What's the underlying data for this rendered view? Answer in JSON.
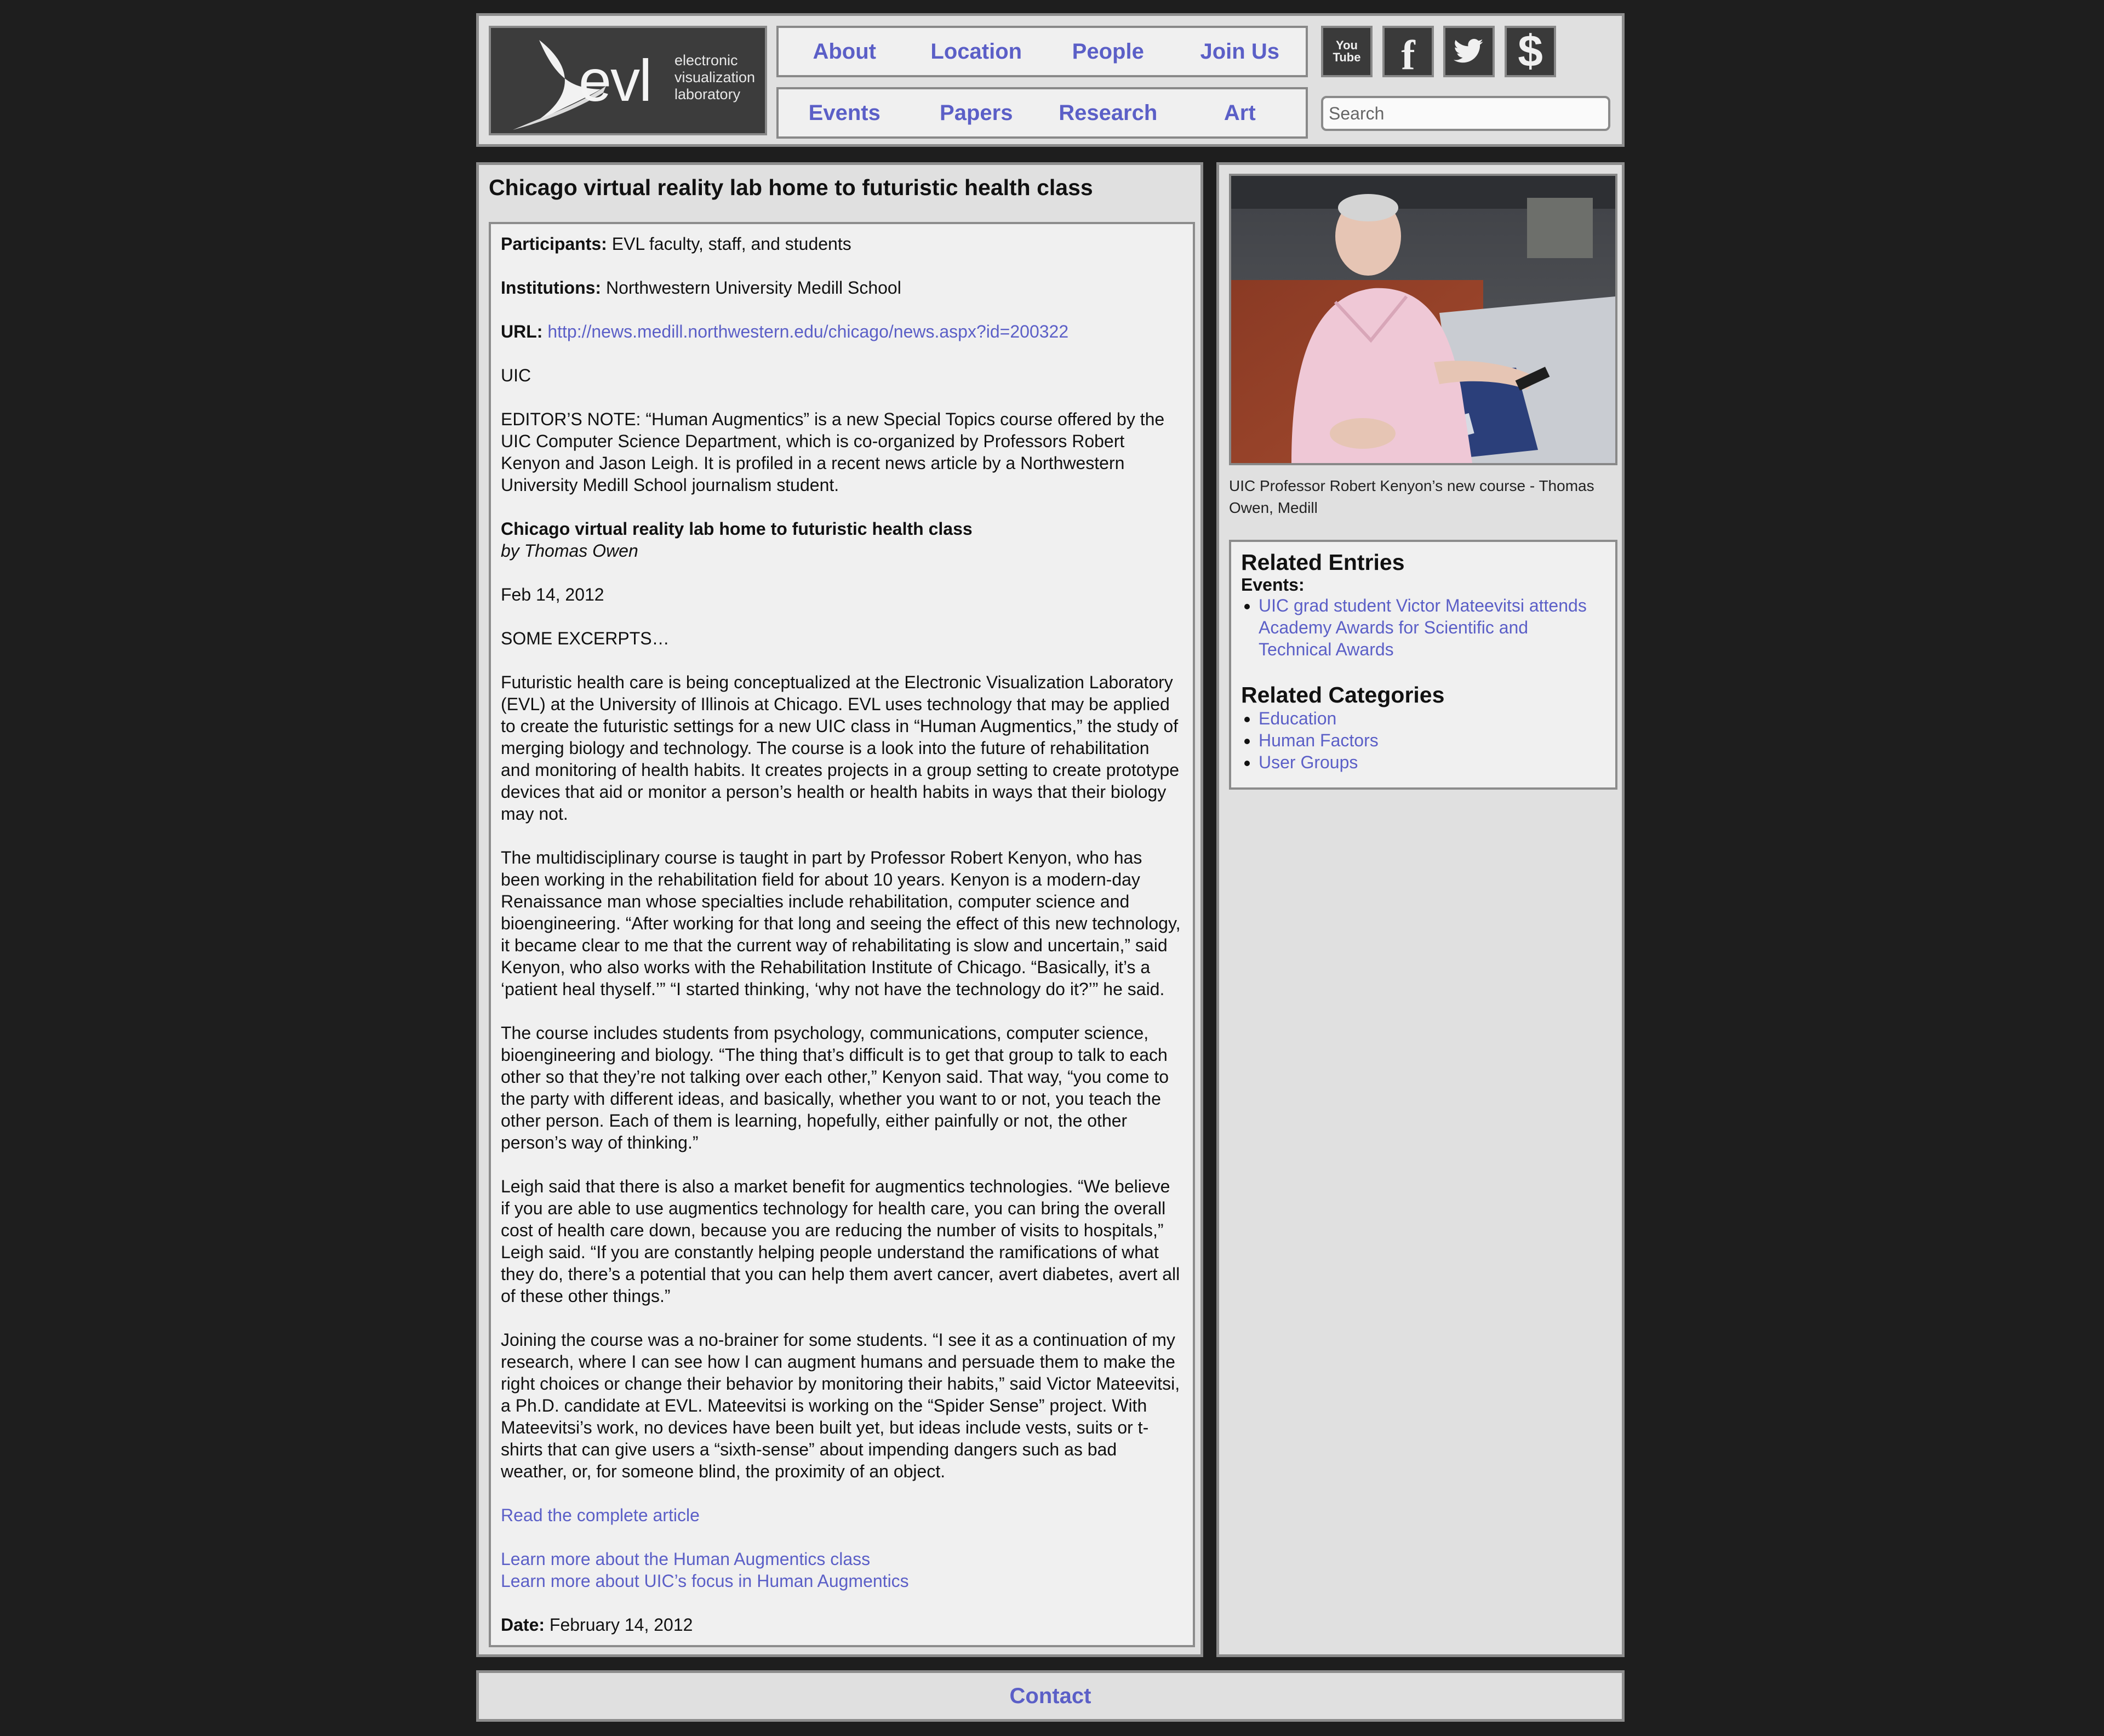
{
  "header": {
    "logo": {
      "wordmark": "evl",
      "lines": [
        "electronic",
        "visualization",
        "laboratory"
      ]
    },
    "nav_row1": [
      "About",
      "Location",
      "People",
      "Join Us"
    ],
    "nav_row2": [
      "Events",
      "Papers",
      "Research",
      "Art"
    ],
    "social": {
      "youtube_label": "You Tube",
      "icons": [
        "youtube-icon",
        "facebook-icon",
        "twitter-icon",
        "dollar-icon"
      ]
    },
    "search_placeholder": "Search"
  },
  "article": {
    "title": "Chicago virtual reality lab home to futuristic health class",
    "participants_label": "Participants:",
    "participants": "EVL faculty, staff, and students",
    "institutions_label": "Institutions:",
    "institutions": "Northwestern University Medill School",
    "url_label": "URL:",
    "url": "http://news.medill.northwestern.edu/chicago/news.aspx?id=200322",
    "uic": "UIC",
    "editors_note": "EDITOR’S NOTE: “Human Augmentics” is a new Special Topics course offered by the UIC Computer Science Department, which is co-organized by Professors Robert Kenyon and Jason Leigh. It is profiled in a recent news article by a Northwestern University Medill School journalism student.",
    "headline": "Chicago virtual reality lab home to futuristic health class",
    "byline": "by Thomas Owen",
    "pub_date": "Feb 14, 2012",
    "excerpts_label": "SOME EXCERPTS…",
    "paragraphs": [
      "Futuristic health care is being conceptualized at the Electronic Visualization Laboratory (EVL) at the University of Illinois at Chicago. EVL uses technology that may be applied to create the futuristic settings for a new UIC class in “Human Augmentics,” the study of merging biology and technology. The course is a look into the future of rehabilitation and monitoring of health habits. It creates projects in a group setting to create prototype devices that aid or monitor a person’s health or health habits in ways that their biology may not.",
      "The multidisciplinary course is taught in part by Professor Robert Kenyon, who has been working in the rehabilitation field for about 10 years. Kenyon is a modern-day Renaissance man whose specialties include rehabilitation, computer science and bioengineering. “After working for that long and seeing the effect of this new technology, it became clear to me that the current way of rehabilitating is slow and uncertain,” said Kenyon, who also works with the Rehabilitation Institute of Chicago. “Basically, it’s a ‘patient heal thyself.’” “I started thinking, ‘why not have the technology do it?’” he said.",
      "The course includes students from psychology, communications, computer science, bioengineering and biology. “The thing that’s difficult is to get that group to talk to each other so that they’re not talking over each other,” Kenyon said. That way, “you come to the party with different ideas, and basically, whether you want to or not, you teach the other person. Each of them is learning, hopefully, either painfully or not, the other person’s way of thinking.”",
      "Leigh said that there is also a market benefit for augmentics technologies. “We believe if you are able to use augmentics technology for health care, you can bring the overall cost of health care down, because you are reducing the number of visits to hospitals,” Leigh said. “If you are constantly helping people understand the ramifications of what they do, there’s a potential that you can help them avert cancer, avert diabetes, avert all of these other things.”",
      "Joining the course was a no-brainer for some students. “I see it as a continuation of my research, where I can see how I can augment humans and persuade them to make the right choices or change their behavior by monitoring their habits,” said Victor Mateevitsi, a Ph.D. candidate at EVL. Mateevitsi is working on the “Spider Sense” project. With Mateevitsi’s work, no devices have been built yet, but ideas include vests, suits or t-shirts that can give users a “sixth-sense” about impending dangers such as bad weather, or, for someone blind, the proximity of an object."
    ],
    "read_more": "Read the complete article",
    "learn_more_1": "Learn more about the Human Augmentics class",
    "learn_more_2": "Learn more about UIC’s focus in Human Augmentics",
    "date_label": "Date:",
    "date": "February 14, 2012"
  },
  "sidebar": {
    "caption": "UIC Professor Robert Kenyon’s new course - Thomas Owen, Medill",
    "related_entries_title": "Related Entries",
    "events_label": "Events:",
    "events": [
      "UIC grad student Victor Mateevitsi attends Academy Awards for Scientific and Technical Awards"
    ],
    "related_categories_title": "Related Categories",
    "categories": [
      "Education",
      "Human Factors",
      "User Groups"
    ]
  },
  "footer": {
    "contact": "Contact"
  }
}
